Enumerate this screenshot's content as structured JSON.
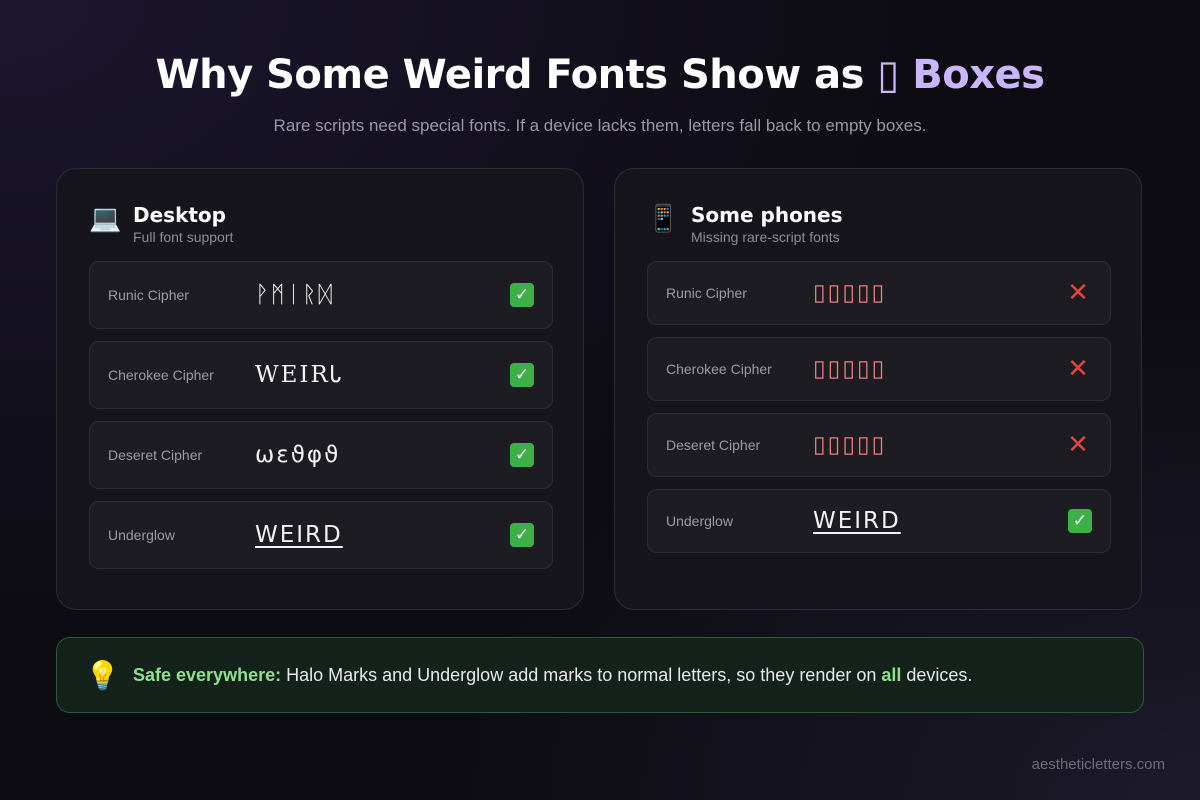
{
  "header": {
    "title_main": "Why Some Weird Fonts Show as",
    "title_accent": "▯ Boxes",
    "subtitle": "Rare scripts need special fonts. If a device lacks them, letters fall back to empty boxes."
  },
  "panels": [
    {
      "icon": "laptop-icon",
      "icon_glyph": "💻",
      "title": "Desktop",
      "subtitle": "Full font support",
      "rows": [
        {
          "label": "Runic Cipher",
          "sample": "ᚹᛗᛁᚱᛞ",
          "status": "ok",
          "status_glyph": "✓"
        },
        {
          "label": "Cherokee Cipher",
          "sample": "WEIRᏓ",
          "status": "ok",
          "status_glyph": "✓"
        },
        {
          "label": "Deseret Cipher",
          "sample": "ωεϑφϑ",
          "status": "ok",
          "status_glyph": "✓"
        },
        {
          "label": "Underglow",
          "sample": "WEIRD",
          "status": "ok",
          "status_glyph": "✓"
        }
      ]
    },
    {
      "icon": "phone-icon",
      "icon_glyph": "📱",
      "title": "Some phones",
      "subtitle": "Missing rare-script fonts",
      "rows": [
        {
          "label": "Runic Cipher",
          "sample": "▯▯▯▯▯",
          "status": "bad",
          "status_glyph": "✕"
        },
        {
          "label": "Cherokee Cipher",
          "sample": "▯▯▯▯▯",
          "status": "bad",
          "status_glyph": "✕"
        },
        {
          "label": "Deseret Cipher",
          "sample": "▯▯▯▯▯",
          "status": "bad",
          "status_glyph": "✕"
        },
        {
          "label": "Underglow",
          "sample": "WEIRD",
          "status": "ok",
          "status_glyph": "✓"
        }
      ]
    }
  ],
  "tip": {
    "icon": "lightbulb-icon",
    "icon_glyph": "💡",
    "lead": "Safe everywhere:",
    "text_before": " Halo Marks and Underglow add marks to normal letters, so they render on ",
    "emphasis": "all",
    "text_after": " devices."
  },
  "footer": {
    "site": "aestheticletters.com"
  },
  "colors": {
    "accent": "#c9b6ff",
    "ok": "#3eb04a",
    "bad": "#e0453e",
    "box_glyph": "#ef7d7d",
    "tip_green": "#8ee08f"
  }
}
